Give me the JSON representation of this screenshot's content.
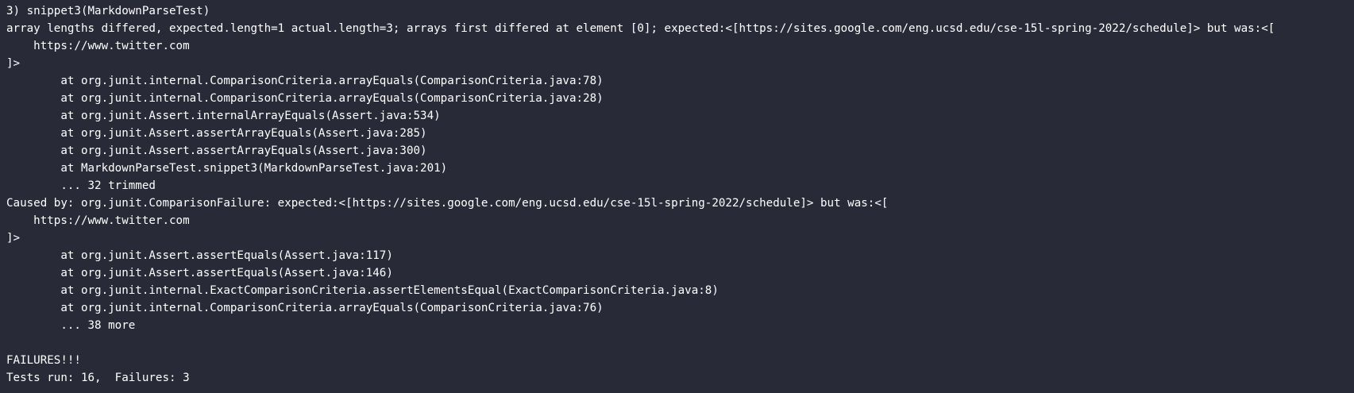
{
  "terminal": {
    "lines": [
      "3) snippet3(MarkdownParseTest)",
      "array lengths differed, expected.length=1 actual.length=3; arrays first differed at element [0]; expected:<[https://sites.google.com/eng.ucsd.edu/cse-15l-spring-2022/schedule]> but was:<[",
      "    https://www.twitter.com",
      "]>",
      "        at org.junit.internal.ComparisonCriteria.arrayEquals(ComparisonCriteria.java:78)",
      "        at org.junit.internal.ComparisonCriteria.arrayEquals(ComparisonCriteria.java:28)",
      "        at org.junit.Assert.internalArrayEquals(Assert.java:534)",
      "        at org.junit.Assert.assertArrayEquals(Assert.java:285)",
      "        at org.junit.Assert.assertArrayEquals(Assert.java:300)",
      "        at MarkdownParseTest.snippet3(MarkdownParseTest.java:201)",
      "        ... 32 trimmed",
      "Caused by: org.junit.ComparisonFailure: expected:<[https://sites.google.com/eng.ucsd.edu/cse-15l-spring-2022/schedule]> but was:<[",
      "    https://www.twitter.com",
      "]>",
      "        at org.junit.Assert.assertEquals(Assert.java:117)",
      "        at org.junit.Assert.assertEquals(Assert.java:146)",
      "        at org.junit.internal.ExactComparisonCriteria.assertElementsEqual(ExactComparisonCriteria.java:8)",
      "        at org.junit.internal.ComparisonCriteria.arrayEquals(ComparisonCriteria.java:76)",
      "        ... 38 more",
      "",
      "FAILURES!!!",
      "Tests run: 16,  Failures: 3"
    ]
  },
  "colors": {
    "background": "#292a38",
    "text": "#ffffff"
  }
}
